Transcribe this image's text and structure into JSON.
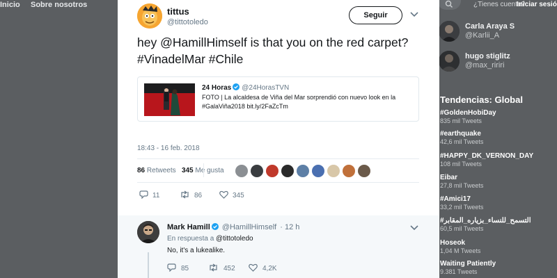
{
  "nav": {
    "home": "Inicio",
    "about": "Sobre nosotros"
  },
  "account": {
    "question": "¿Tienes cuenta?",
    "login": "Iniciar sesión"
  },
  "sidebar": {
    "who_to_follow": [
      {
        "name": "Carla Araya S",
        "handle": "@Karlii_A"
      },
      {
        "name": "hugo stiglitz",
        "handle": "@max_ririri"
      }
    ],
    "trends_title": "Tendencias: Global",
    "trends": [
      {
        "name": "#GoldenHobiDay",
        "count": "835 mil Tweets"
      },
      {
        "name": "#earthquake",
        "count": "42,6 mil Tweets"
      },
      {
        "name": "#HAPPY_DK_VERNON_DAY",
        "count": "108 mil Tweets"
      },
      {
        "name": "Eibar",
        "count": "27,8 mil Tweets"
      },
      {
        "name": "#Amici17",
        "count": "33,2 mil Tweets"
      },
      {
        "name": "#التسمح_للنساء_بزياره_المقابر",
        "count": "60,5 mil Tweets"
      },
      {
        "name": "Hoseok",
        "count": "1,04 M Tweets"
      },
      {
        "name": "Waiting Patiently",
        "count": "9.381 Tweets"
      }
    ]
  },
  "tweet": {
    "author_name": "tittus",
    "author_handle": "@tittotoledo",
    "follow_label": "Seguir",
    "text": "hey @HamillHimself  is that you on the red carpet? #VinadelMar #Chile",
    "card": {
      "name": "24 Horas",
      "handle": "@24HorasTVN",
      "text": "FOTO | La alcaldesa de Viña del Mar sorprendió con nuevo look en la #GalaViña2018 bit.ly/2FaZcTm"
    },
    "timestamp": "18:43 - 16 feb. 2018",
    "retweets_count": "86",
    "retweets_label": "Retweets",
    "likes_count": "345",
    "likes_label": "Me gusta",
    "replies": "11",
    "retweets": "86",
    "likes": "345"
  },
  "reply": {
    "name": "Mark Hamill",
    "handle": "@HamillHimself",
    "time": "· 12 h",
    "reply_prefix": "En respuesta a",
    "reply_to": "@tittotoledo",
    "text": "No, it's a lukealike.",
    "replies": "85",
    "retweets": "452",
    "likes": "4,2K"
  },
  "colors": {
    "verified": "#1da1f2",
    "overlay": "#5b5e61",
    "brand_text": "#14171a",
    "muted": "#657786"
  }
}
